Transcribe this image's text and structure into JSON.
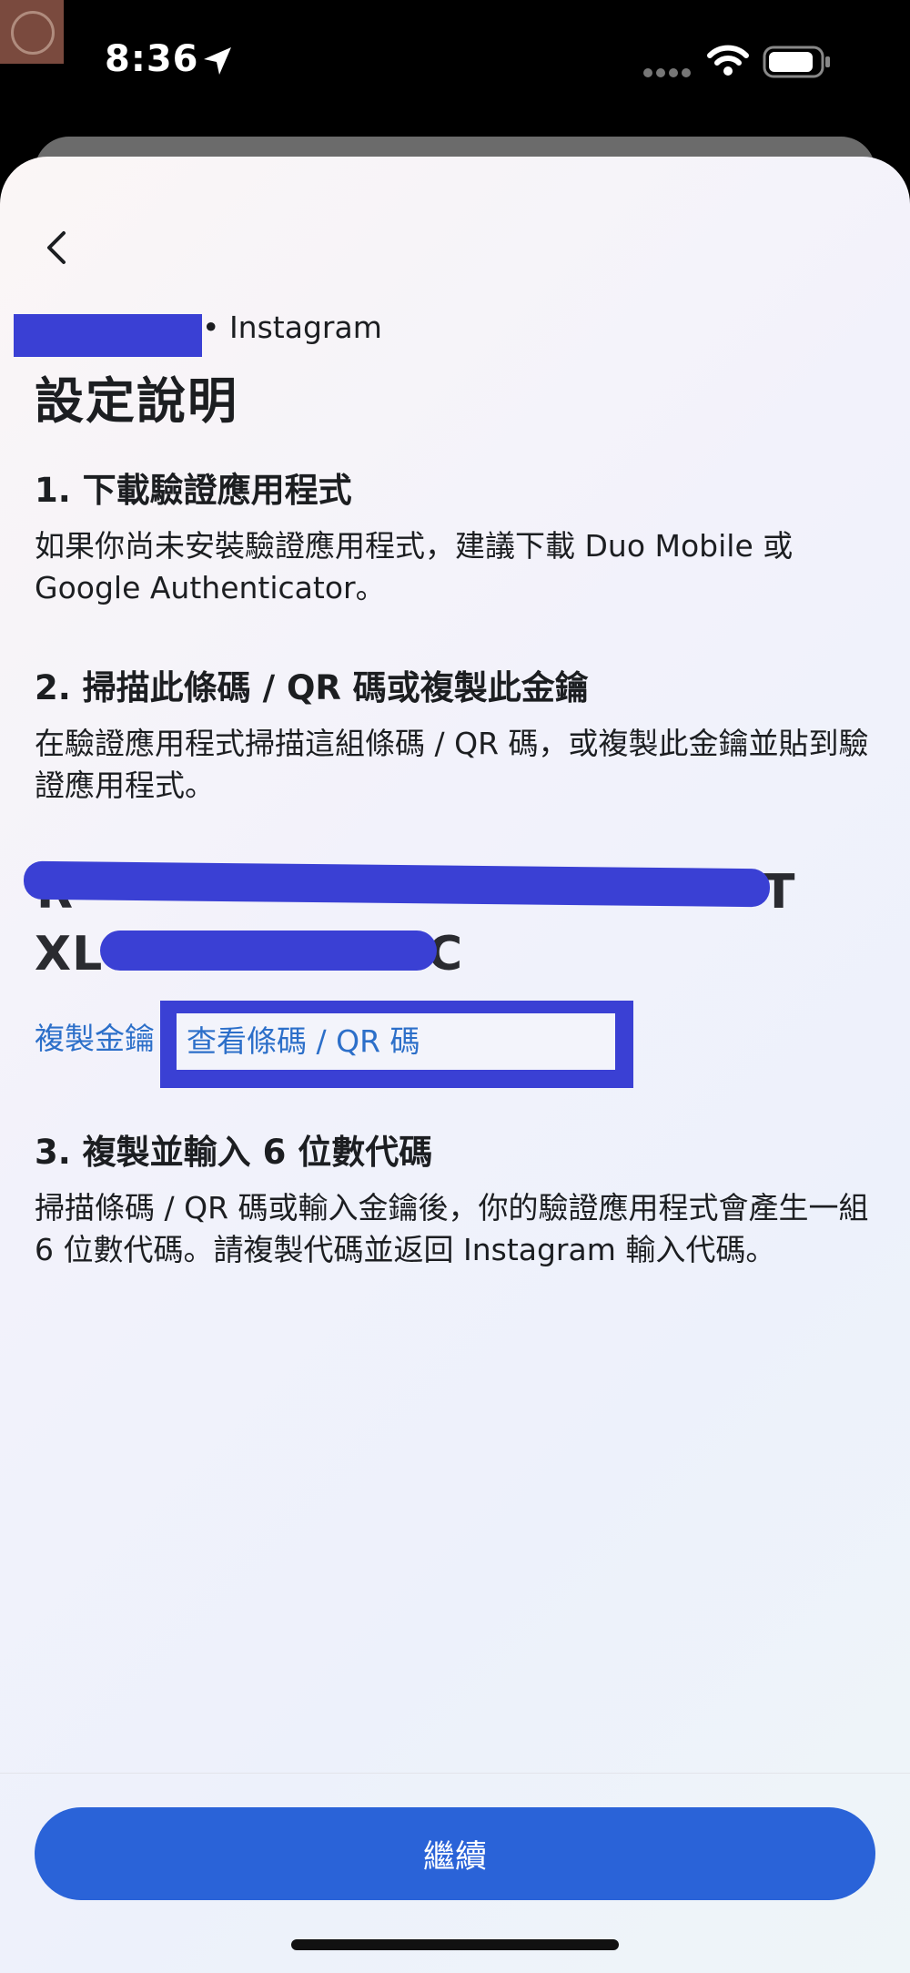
{
  "status_bar": {
    "time": "8:36"
  },
  "header": {
    "account_suffix": "• Instagram",
    "title": "設定說明"
  },
  "steps": [
    {
      "heading": "1. 下載驗證應用程式",
      "body": "如果你尚未安裝驗證應用程式，建議下載 Duo Mobile 或 Google Authenticator。"
    },
    {
      "heading": "2. 掃描此條碼 / QR 碼或複製此金鑰",
      "body": "在驗證應用程式掃描這組條碼 / QR 碼，或複製此金鑰並貼到驗證應用程式。"
    },
    {
      "heading": "3. 複製並輸入 6 位數代碼",
      "body": "掃描條碼 / QR 碼或輸入金鑰後，你的驗證應用程式會產生一組 6 位數代碼。請複製代碼並返回 Instagram 輸入代碼。"
    }
  ],
  "key": {
    "line1_start": "R",
    "line1_end": "T",
    "line2_start": "XL",
    "line2_end": "C"
  },
  "actions": {
    "copy_key": "複製金鑰",
    "view_qr": "查看條碼 / QR 碼",
    "continue": "繼續"
  },
  "colors": {
    "accent": "#2a63d8",
    "link": "#2c6fc9",
    "redaction": "#3a40d4"
  }
}
